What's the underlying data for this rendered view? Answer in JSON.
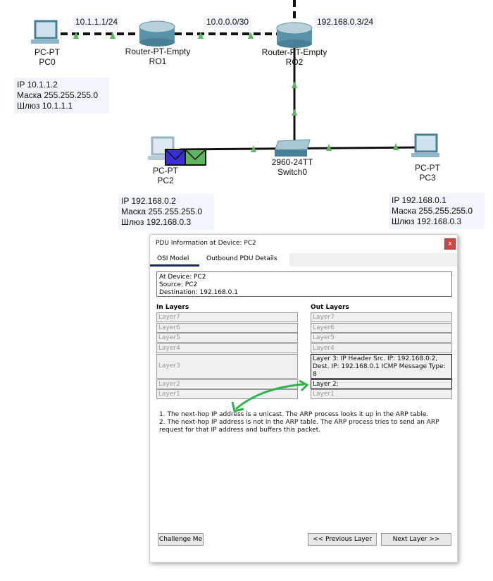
{
  "network": {
    "links": {
      "pc0_ro1": "10.1.1.1/24",
      "ro1_ro2": "10.0.0.0/30",
      "ro2_lan": "192.168.0.3/24"
    },
    "devices": [
      {
        "model": "PC-PT",
        "name": "PC0"
      },
      {
        "model": "Router-PT-Empty",
        "name": "RO1"
      },
      {
        "model": "Router-PT-Empty",
        "name": "RO2"
      },
      {
        "model": "PC-PT",
        "name": "PC2"
      },
      {
        "model": "2960-24TT",
        "name": "Switch0"
      },
      {
        "model": "PC-PT",
        "name": "PC3"
      }
    ],
    "info": {
      "pc0": [
        "IP 10.1.1.2",
        "Маска 255.255.255.0",
        "Шлюз 10.1.1.1"
      ],
      "pc2": [
        "IP 192.168.0.2",
        "Маска 255.255.255.0",
        "Шлюз 192.168.0.3"
      ],
      "pc3": [
        "IP 192.168.0.1",
        "Маска 255.255.255.0",
        "Шлюз 192.168.0.3"
      ]
    },
    "colors": {
      "link_light": "#5cb85c",
      "envelope1": "#3a2fd6",
      "envelope2": "#5fb45f"
    }
  },
  "dialog": {
    "title": "PDU Information at Device: PC2",
    "close": "x",
    "tabs": [
      "OSI Model",
      "Outbound PDU Details"
    ],
    "summary": [
      "At Device: PC2",
      "Source: PC2",
      "Destination: 192.168.0.1"
    ],
    "in_header": "In Layers",
    "out_header": "Out Layers",
    "in_layers": [
      "Layer7",
      "Layer6",
      "Layer5",
      "Layer4",
      "Layer3",
      "Layer2",
      "Layer1"
    ],
    "out_layers": [
      "Layer7",
      "Layer6",
      "Layer5",
      "Layer4",
      "Layer 3: IP Header Src. IP: 192.168.0.2, Dest. IP: 192.168.0.1 ICMP Message Type: 8",
      "Layer 2:",
      "Layer1"
    ],
    "notes": [
      "1. The next-hop IP address is a unicast. The ARP process looks it up in the ARP table.",
      "2. The next-hop IP address is not in the ARP table. The ARP process tries to send an ARP request for that IP address and buffers this packet."
    ],
    "buttons": {
      "challenge": "Challenge Me",
      "previous": "<< Previous Layer",
      "next": "Next Layer >>"
    }
  }
}
